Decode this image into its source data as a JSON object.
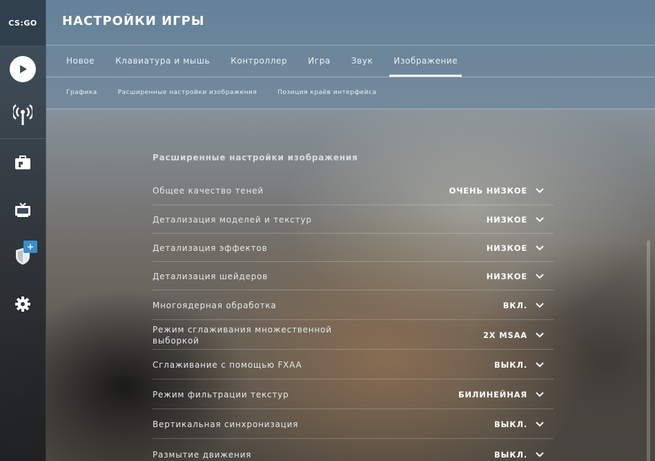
{
  "app": {
    "logo_text": "CS:GO"
  },
  "header": {
    "title": "НАСТРОЙКИ ИГРЫ",
    "tabs": [
      {
        "label": "Новое"
      },
      {
        "label": "Клавиатура и мышь"
      },
      {
        "label": "Контроллер"
      },
      {
        "label": "Игра"
      },
      {
        "label": "Звук"
      },
      {
        "label": "Изображение",
        "active": true
      }
    ],
    "subtabs": [
      {
        "label": "Графика"
      },
      {
        "label": "Расширенные настройки изображения"
      },
      {
        "label": "Позиция краёв интерфейса"
      }
    ]
  },
  "sidebar": {
    "items": [
      {
        "icon": "play-icon"
      },
      {
        "icon": "broadcast-icon"
      },
      {
        "icon": "inventory-icon"
      },
      {
        "icon": "tv-icon"
      },
      {
        "icon": "shield-icon",
        "badge": "+"
      },
      {
        "icon": "gear-icon"
      }
    ]
  },
  "section": {
    "title": "Расширенные настройки изображения"
  },
  "settings": [
    {
      "label": "Общее качество теней",
      "value": "ОЧЕНЬ НИЗКОЕ"
    },
    {
      "label": "Детализация моделей и текстур",
      "value": "НИЗКОЕ"
    },
    {
      "label": "Детализация эффектов",
      "value": "НИЗКОЕ"
    },
    {
      "label": "Детализация шейдеров",
      "value": "НИЗКОЕ"
    },
    {
      "label": "Многоядерная обработка",
      "value": "ВКЛ."
    },
    {
      "label": "Режим сглаживания множественной выборкой",
      "value": "2X MSAA"
    },
    {
      "label": "Сглаживание с помощью FXAA",
      "value": "ВЫКЛ."
    },
    {
      "label": "Режим фильтрации текстур",
      "value": "БИЛИНЕЙНАЯ"
    },
    {
      "label": "Вертикальная синхронизация",
      "value": "ВЫКЛ."
    },
    {
      "label": "Размытие движения",
      "value": "ВЫКЛ."
    }
  ],
  "colors": {
    "accent": "#ffffff",
    "badge": "#3a8fc8",
    "header_bg": "#6e8aa0"
  }
}
